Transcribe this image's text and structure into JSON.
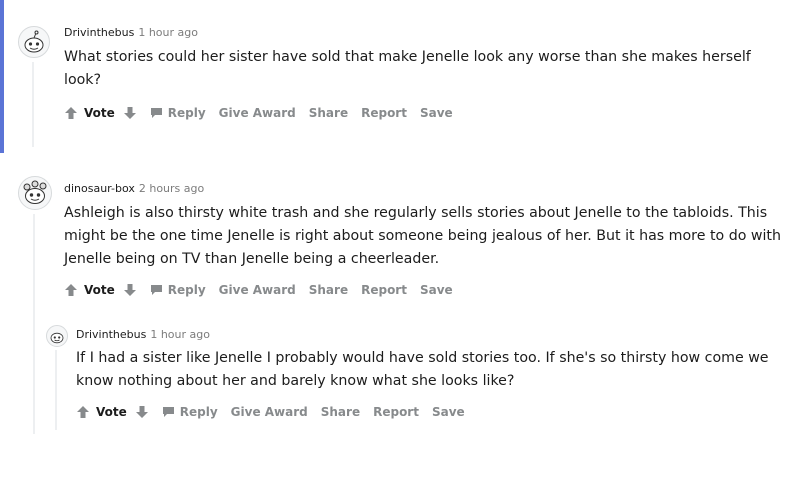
{
  "actions": {
    "vote": "Vote",
    "reply": "Reply",
    "give_award": "Give Award",
    "share": "Share",
    "report": "Report",
    "save": "Save"
  },
  "comments": [
    {
      "author": "Drivinthebus",
      "time": "1 hour ago",
      "text": "What stories could her sister have sold that make Jenelle look any worse than she makes herself look?"
    },
    {
      "author": "dinosaur-box",
      "time": "2 hours ago",
      "text": "Ashleigh is also thirsty white trash and she regularly sells stories about Jenelle to the tabloids. This might be the one time Jenelle is right about someone being jealous of her. But it has more to do with Jenelle being on TV than Jenelle being a cheerleader."
    },
    {
      "author": "Drivinthebus",
      "time": "1 hour ago",
      "text": "If I had a sister like Jenelle I probably would have sold stories too. If she's so thirsty how come we know nothing about her and barely know what she looks like?"
    }
  ],
  "colors": {
    "accent": "#5b74d6",
    "meta_gray": "#7c7c7c",
    "action_gray": "#878a8c"
  }
}
